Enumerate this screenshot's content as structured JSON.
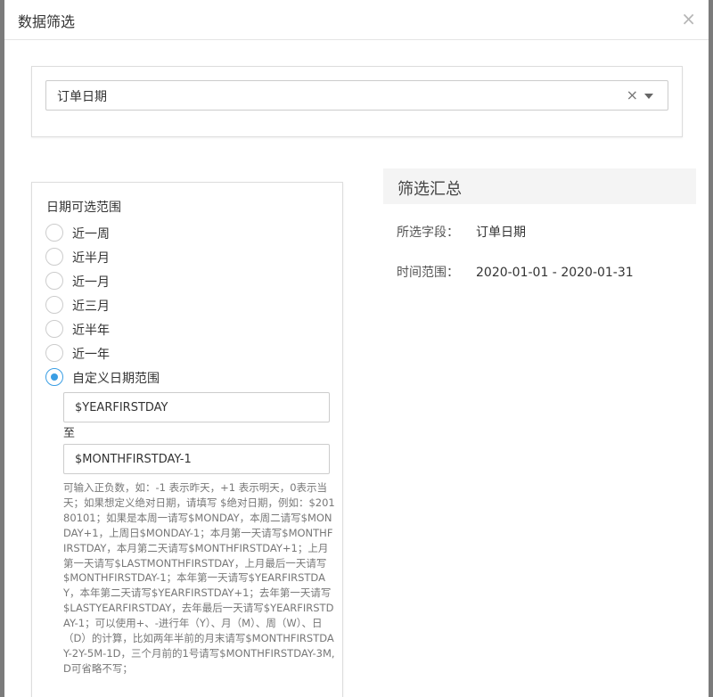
{
  "modal": {
    "title": "数据筛选",
    "close": "×"
  },
  "field_select": {
    "value": "订单日期",
    "clear": "×"
  },
  "date_range": {
    "title": "日期可选范围",
    "options": [
      {
        "label": "近一周",
        "checked": false
      },
      {
        "label": "近半月",
        "checked": false
      },
      {
        "label": "近一月",
        "checked": false
      },
      {
        "label": "近三月",
        "checked": false
      },
      {
        "label": "近半年",
        "checked": false
      },
      {
        "label": "近一年",
        "checked": false
      },
      {
        "label": "自定义日期范围",
        "checked": true
      }
    ],
    "start_value": "$YEARFIRSTDAY",
    "to_label": "至",
    "end_value": "$MONTHFIRSTDAY-1",
    "help": "可输入正负数，如：-1 表示昨天，+1 表示明天，0表示当天；如果想定义绝对日期，请填写 $绝对日期，例如：$20180101；如果是本周一请写$MONDAY，本周二请写$MONDAY+1，上周日$MONDAY-1；本月第一天请写$MONTHFIRSTDAY，本月第二天请写$MONTHFIRSTDAY+1；上月第一天请写$LASTMONTHFIRSTDAY，上月最后一天请写$MONTHFIRSTDAY-1；本年第一天请写$YEARFIRSTDAY，本年第二天请写$YEARFIRSTDAY+1；去年第一天请写$LASTYEARFIRSTDAY，去年最后一天请写$YEARFIRSTDAY-1；可以使用+、-进行年（Y）、月（M）、周（W）、日（D）的计算，比如两年半前的月末请写$MONTHFIRSTDAY-2Y-5M-1D，三个月前的1号请写$MONTHFIRSTDAY-3M,D可省略不写；"
  },
  "summary": {
    "title": "筛选汇总",
    "field_key": "所选字段：",
    "field_value": "订单日期",
    "range_key": "时间范围：",
    "range_value": "2020-01-01 - 2020-01-31"
  },
  "colors": {
    "accent": "#3a9ee4",
    "border": "#dddddd",
    "summary_bg": "#f4f4f4",
    "backdrop": "#7b7b7b"
  }
}
